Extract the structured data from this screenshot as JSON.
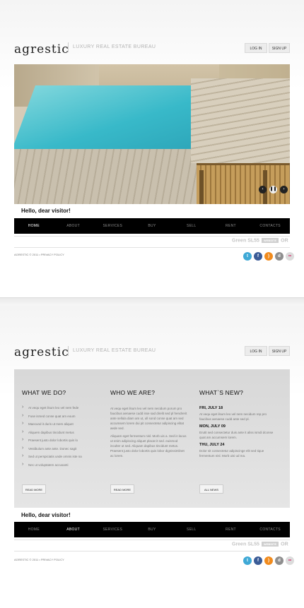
{
  "brand": {
    "logo_main": "agrestic",
    "tagline": "LUXURY REAL ESTATE BUREAU"
  },
  "header": {
    "login": "LOG IN",
    "signup": "SIGN UP"
  },
  "hero": {
    "prev": "‹",
    "play": "❚❚",
    "next": "›"
  },
  "greeting": "Hello, dear visitor!",
  "nav": [
    "HOME",
    "ABOUT",
    "SERVICES",
    "BUY",
    "SELL",
    "RENT",
    "CONTACTS"
  ],
  "powered": {
    "label": "Green",
    "code": "SL55",
    "badge": "WEBSITE",
    "tail": "OR"
  },
  "footer": "AGRESTIC © 2011 • PRIVACY POLICY",
  "social": [
    {
      "icon": "twitter-icon",
      "glyph": "t",
      "color": "#3fa9d6"
    },
    {
      "icon": "facebook-icon",
      "glyph": "f",
      "color": "#3b5c97"
    },
    {
      "icon": "rss-icon",
      "glyph": ")",
      "color": "#f18b1d"
    },
    {
      "icon": "delicious-icon",
      "glyph": "d",
      "color": "#8f8f8f"
    },
    {
      "icon": "flickr-icon",
      "glyph": "••",
      "color": "#dcdcdc"
    }
  ],
  "sections": {
    "what_we_do": {
      "title": "WHAT WE DO?",
      "items": [
        "At vequ eget ilsum leo vel nem fede",
        "Fuse ismed conse quat am eoum",
        "Maecund it duris ut mem aliquet",
        "Aliquem dapibus tincidunt metus",
        "Praesent justo dolor lobortis quis lo",
        "Vestibulum ante ante. Donec sagit",
        "Sed ut perspiciatis unde omnis iste na",
        "Nec ut voluptatem accusanti"
      ],
      "more": "READ MORE"
    },
    "who_we_are": {
      "title": "WHO WE ARE?",
      "p1": "At vequ eget ilsum leo vel nem necidum porum pro faucibus aenaese cudd isse sad direlit sed pl hendrerit ante sellula diam am ut, ull sond conse quat am sed accumsem lorem dui pit consectetur adipiscing elitat aede sed.",
      "p2": "Aliquam eget fermentum nisl. Morb uis a. Sed in lacus ut enim adipiscing aliquet placat it sed. euismod inculter ut sed. Aliquam dapibus tincidunt metus. Praesent justo dolor lobortis quis lobor dignissimlinet ac lorem.",
      "more": "READ MORE"
    },
    "whats_new": {
      "title": "WHAT`S NEW?",
      "items": [
        {
          "date": "FRI, JULY 18",
          "text": "At vequ eget ilsum leo vel nem necidum rep pro faucibus aenaese cudd ante sed pl."
        },
        {
          "date": "MON, JULY 09",
          "text": "Erutit sed consectetur duis ante it aliss ismdi dconse quat am accumsem lorem."
        },
        {
          "date": "THU, JULY 24",
          "text": "Dolor sit consectetur adipiscinge elit sed tique fermentum nisl. Morb uisi ud ma."
        }
      ],
      "more": "ALL NEWS"
    }
  }
}
